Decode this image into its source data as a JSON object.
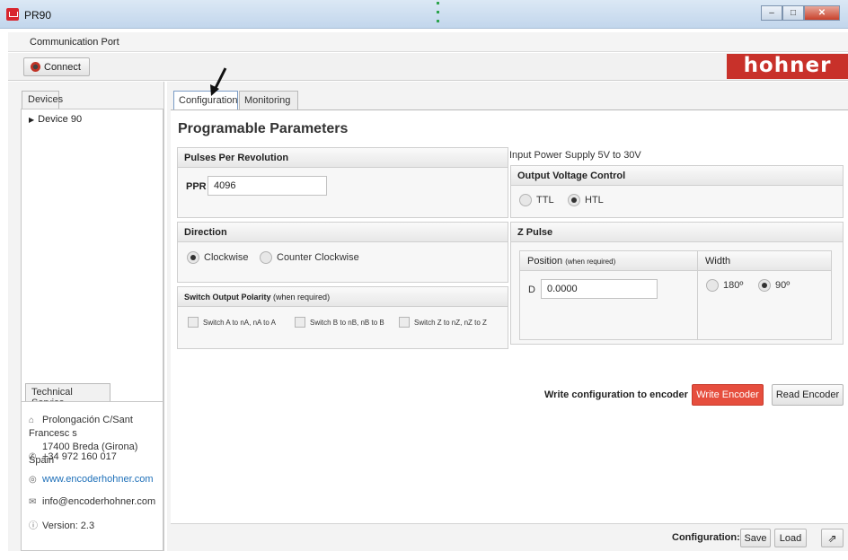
{
  "window": {
    "title": "PR90"
  },
  "menu": {
    "communication_port": "Communication Port"
  },
  "toolbar": {
    "connect_label": "Connect",
    "logo_text": "hohner"
  },
  "left": {
    "devices_tab": "Devices",
    "devices": [
      "Device 90"
    ],
    "technical_tab": "Technical Service",
    "address_line1": "Prolongación C/Sant Francesc s",
    "address_line2": "17400 Breda (Girona) Spain",
    "phone": "+34 972 160 017",
    "website": "www.encoderhohner.com",
    "email": "info@encoderhohner.com",
    "version": "Version: 2.3"
  },
  "main": {
    "tabs": {
      "configuration": "Configuration",
      "monitoring": "Monitoring"
    },
    "heading": "Programable Parameters",
    "ppr": {
      "title": "Pulses Per Revolution",
      "label": "PPR",
      "value": "4096"
    },
    "direction": {
      "title": "Direction",
      "clockwise": "Clockwise",
      "counter": "Counter Clockwise",
      "selected": "Clockwise"
    },
    "polarity": {
      "title": "Switch Output Polarity",
      "title_note": "(when required)",
      "options": [
        "Switch A to nA, nA to A",
        "Switch B to nB, nB to B",
        "Switch Z to nZ, nZ to Z"
      ]
    },
    "power_supply": "Input Power Supply 5V to 30V",
    "output_voltage": {
      "title": "Output Voltage Control",
      "ttl": "TTL",
      "htl": "HTL",
      "selected": "HTL"
    },
    "z_pulse": {
      "title": "Z Pulse",
      "position_title": "Position",
      "position_note": "(when required)",
      "d_label": "D",
      "d_value": "0.0000",
      "width_title": "Width",
      "w180": "180º",
      "w90": "90º",
      "selected": "90º"
    },
    "write_label": "Write configuration to encoder",
    "write_button": "Write Encoder",
    "read_button": "Read Encoder",
    "footer": {
      "configuration": "Configuration:",
      "save": "Save",
      "load": "Load"
    }
  },
  "colors": {
    "accent_red": "#e64e3e",
    "logo_red": "#c8312a",
    "link_blue": "#1d6fb8"
  },
  "icons": [
    "app-icon",
    "plug-icon",
    "home-icon",
    "phone-icon",
    "globe-icon",
    "mail-icon",
    "info-icon",
    "export-icon",
    "minimize-icon",
    "maximize-icon",
    "close-icon"
  ]
}
